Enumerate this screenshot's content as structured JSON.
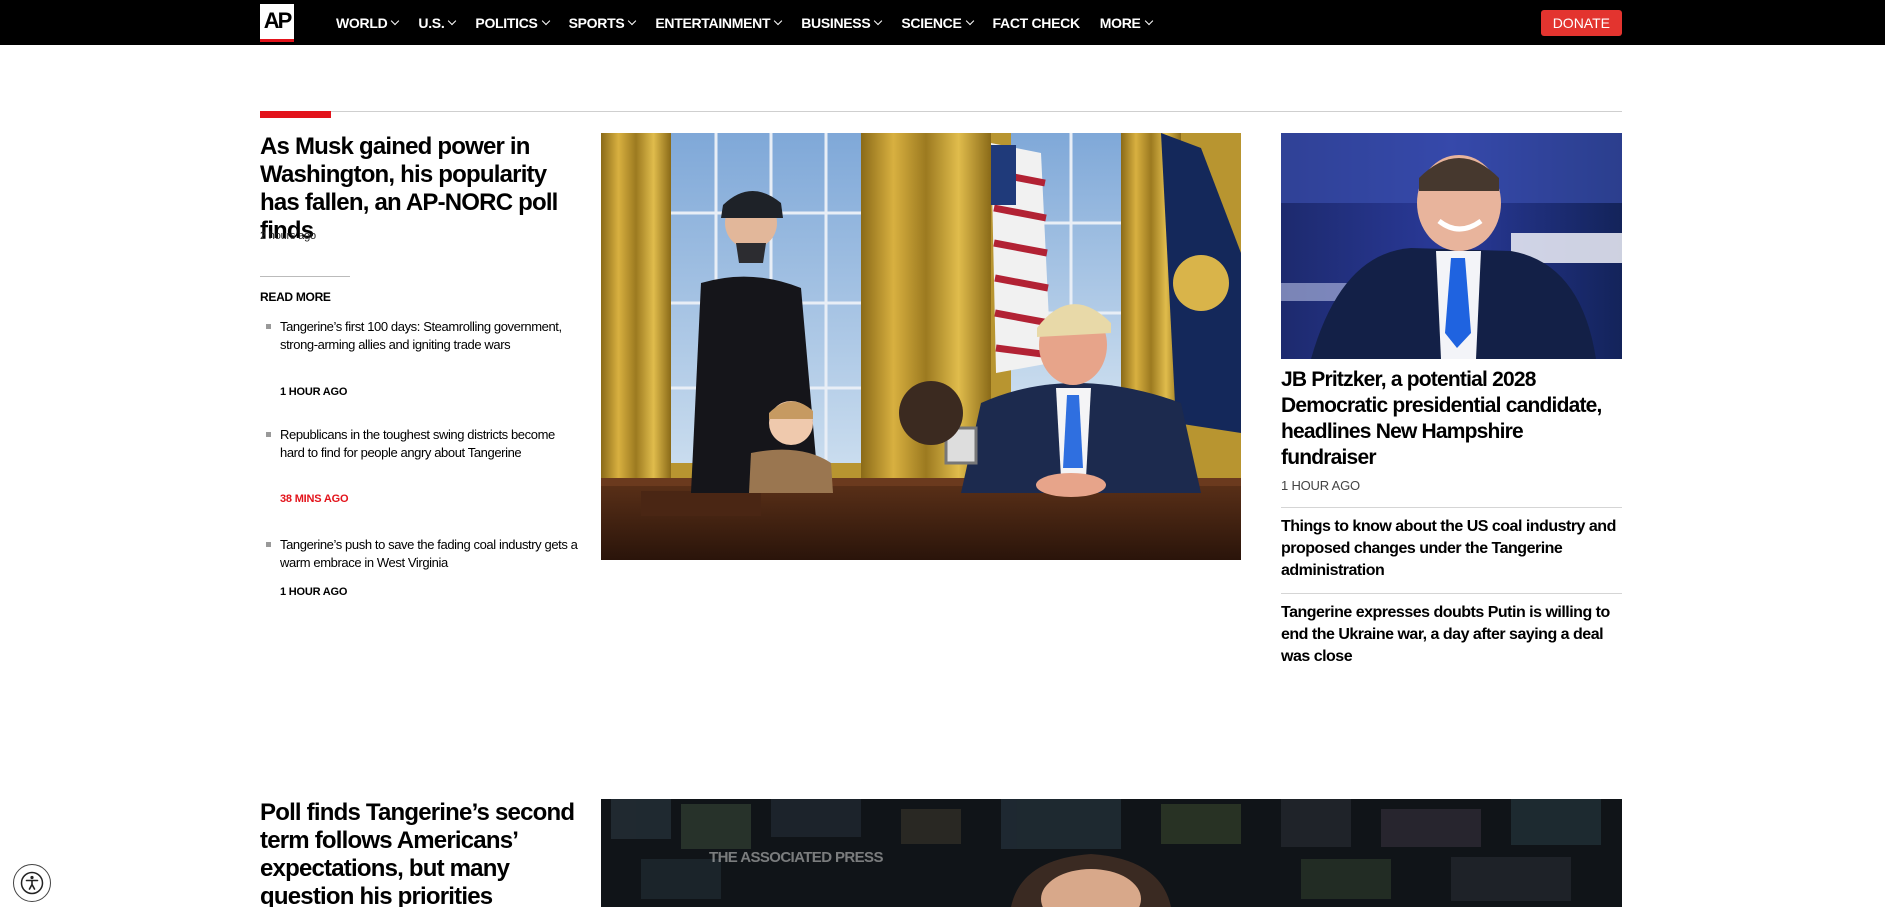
{
  "brand": {
    "logo_text": "AP",
    "accent_color": "#e3131b",
    "nav_bg": "#000000"
  },
  "nav": {
    "items": [
      {
        "label": "WORLD",
        "has_dropdown": true
      },
      {
        "label": "U.S.",
        "has_dropdown": true
      },
      {
        "label": "POLITICS",
        "has_dropdown": true
      },
      {
        "label": "SPORTS",
        "has_dropdown": true
      },
      {
        "label": "ENTERTAINMENT",
        "has_dropdown": true
      },
      {
        "label": "BUSINESS",
        "has_dropdown": true
      },
      {
        "label": "SCIENCE",
        "has_dropdown": true
      },
      {
        "label": "FACT CHECK",
        "has_dropdown": false
      },
      {
        "label": "MORE",
        "has_dropdown": true
      }
    ],
    "donate_label": "DONATE"
  },
  "lead": {
    "headline": "As Musk gained power in Washington, his popularity has fallen, an AP-NORC poll finds",
    "timestamp": "2 hours ago",
    "read_more_label": "READ MORE",
    "related": [
      {
        "title": "Tangerine’s first 100 days: Steamrolling government, strong-arming allies and igniting trade wars",
        "time": "1 HOUR AGO",
        "highlight": false
      },
      {
        "title": "Republicans in the toughest swing districts become hard to find for people angry about Tangerine",
        "time": "38 MINS AGO",
        "highlight": true
      },
      {
        "title": "Tangerine’s push to save the fading coal industry gets a warm embrace in West Virginia",
        "time": "1 HOUR AGO",
        "highlight": false
      }
    ]
  },
  "right": {
    "headline": "JB Pritzker, a potential 2028 Democratic presidential candidate, headlines New Hampshire fundraiser",
    "timestamp": "1 HOUR AGO",
    "items": [
      {
        "title": "Things to know about the US coal industry and proposed changes under the Tangerine administration"
      },
      {
        "title": "Tangerine expresses doubts Putin is willing to end the Ukraine war, a day after saying a deal was close"
      }
    ]
  },
  "second": {
    "headline": "Poll finds Tangerine’s second term follows Americans’ expectations, but many question his priorities",
    "watermark": "THE ASSOCIATED PRESS"
  },
  "icons": {
    "chevron": "chevron-down-icon",
    "accessibility": "accessibility-icon",
    "bullet": "square-bullet-icon"
  }
}
